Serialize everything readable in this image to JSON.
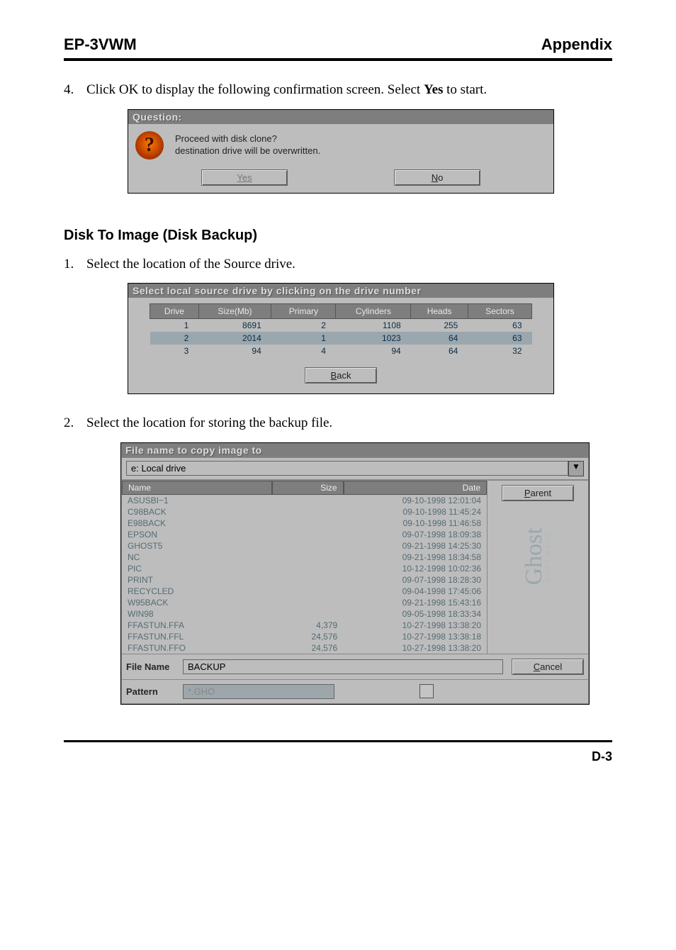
{
  "header": {
    "left": "EP-3VWM",
    "right": "Appendix"
  },
  "step4": {
    "num": "4.",
    "text_before": "Click OK to display the following confirmation screen.  Select ",
    "text_bold": "Yes",
    "text_after": " to start."
  },
  "question_dialog": {
    "title": "Question:",
    "line1": "Proceed with disk clone?",
    "line2": "destination drive will be overwritten.",
    "yes": "Yes",
    "no": "No"
  },
  "section_heading": "Disk To Image (Disk Backup)",
  "step1": {
    "num": "1.",
    "text": "Select the location of the Source drive."
  },
  "drive_dialog": {
    "title": "Select local source drive by clicking on the drive number",
    "headers": [
      "Drive",
      "Size(Mb)",
      "Primary",
      "Cylinders",
      "Heads",
      "Sectors"
    ],
    "rows": [
      {
        "cells": [
          "1",
          "8691",
          "2",
          "1108",
          "255",
          "63"
        ],
        "selected": false
      },
      {
        "cells": [
          "2",
          "2014",
          "1",
          "1023",
          "64",
          "63"
        ],
        "selected": true
      },
      {
        "cells": [
          "3",
          "94",
          "4",
          "94",
          "64",
          "32"
        ],
        "selected": false
      }
    ],
    "back": "Back"
  },
  "step2": {
    "num": "2.",
    "text": "Select the location for storing the backup file."
  },
  "file_dialog": {
    "title": "File name to copy image to",
    "drive_label": "e: Local drive",
    "headers": {
      "name": "Name",
      "size": "Size",
      "date": "Date"
    },
    "rows": [
      {
        "name": "ASUSBI~1",
        "size": "",
        "date": "09-10-1998 12:01:04"
      },
      {
        "name": "C98BACK",
        "size": "",
        "date": "09-10-1998 11:45:24"
      },
      {
        "name": "E98BACK",
        "size": "",
        "date": "09-10-1998 11:46:58"
      },
      {
        "name": "EPSON",
        "size": "",
        "date": "09-07-1998 18:09:38"
      },
      {
        "name": "GHOST5",
        "size": "",
        "date": "09-21-1998 14:25:30"
      },
      {
        "name": "NC",
        "size": "",
        "date": "09-21-1998 18:34:58"
      },
      {
        "name": "PIC",
        "size": "",
        "date": "10-12-1998 10:02:36"
      },
      {
        "name": "PRINT",
        "size": "",
        "date": "09-07-1998 18:28:30"
      },
      {
        "name": "RECYCLED",
        "size": "",
        "date": "09-04-1998 17:45:06"
      },
      {
        "name": "W95BACK",
        "size": "",
        "date": "09-21-1998 15:43:16"
      },
      {
        "name": "WIN98",
        "size": "",
        "date": "09-05-1998 18:33:34"
      },
      {
        "name": "FFASTUN.FFA",
        "size": "4,379",
        "date": "10-27-1998 13:38:20"
      },
      {
        "name": "FFASTUN.FFL",
        "size": "24,576",
        "date": "10-27-1998 13:38:18"
      },
      {
        "name": "FFASTUN.FFO",
        "size": "24,576",
        "date": "10-27-1998 13:38:20"
      }
    ],
    "parent": "Parent",
    "cancel": "Cancel",
    "file_name_label": "File Name",
    "file_name_value": "BACKUP",
    "pattern_label": "Pattern",
    "pattern_value": "*.GHO"
  },
  "footer": {
    "page": "D-3"
  }
}
